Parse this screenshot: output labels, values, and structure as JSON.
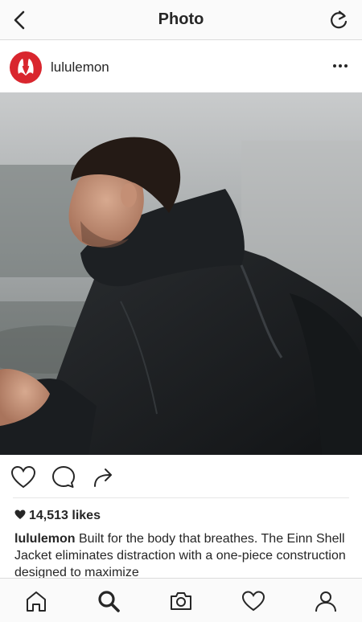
{
  "header": {
    "title": "Photo",
    "back_icon": "chevron-left-icon",
    "refresh_icon": "refresh-icon"
  },
  "post": {
    "username": "lululemon",
    "avatar_color": "#d9262e",
    "more_icon": "more-options-icon"
  },
  "actions": {
    "like_icon": "heart-icon",
    "comment_icon": "comment-icon",
    "share_icon": "share-icon"
  },
  "likes": {
    "count_text": "14,513 likes"
  },
  "caption": {
    "username": "lululemon",
    "text": " Built for the body that breathes. The Einn Shell Jacket eliminates distraction with a one-piece construction designed to maximize"
  },
  "tabbar": {
    "items": [
      "home-icon",
      "search-icon",
      "camera-icon",
      "activity-heart-icon",
      "profile-icon"
    ],
    "active": "search-icon"
  }
}
